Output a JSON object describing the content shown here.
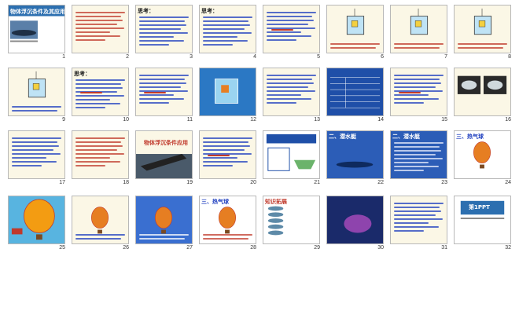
{
  "slides": [
    {
      "n": "1",
      "style": "title",
      "bg": "#ffffff",
      "title": "物体浮沉条件及其应用",
      "title_color": "#c0392b"
    },
    {
      "n": "2",
      "style": "text",
      "bg": "#fbf7e6",
      "line": "#c0392b"
    },
    {
      "n": "3",
      "style": "question",
      "bg": "#fbf7e6",
      "title": "思考：",
      "title_color": "#222222",
      "line": "#1f3fbf"
    },
    {
      "n": "4",
      "style": "text",
      "bg": "#fbf7e6",
      "title": "思考：",
      "title_color": "#222222",
      "line": "#1f3fbf"
    },
    {
      "n": "5",
      "style": "text",
      "bg": "#fbf7e6",
      "line": "#1f3fbf",
      "accent": "#c0392b"
    },
    {
      "n": "6",
      "style": "beaker",
      "bg": "#fbf7e6",
      "line": "#c0392b"
    },
    {
      "n": "7",
      "style": "beaker",
      "bg": "#fbf7e6",
      "line": "#c0392b"
    },
    {
      "n": "8",
      "style": "beaker",
      "bg": "#fbf7e6",
      "line": "#c0392b"
    },
    {
      "n": "9",
      "style": "beaker",
      "bg": "#fbf7e6",
      "line": "#1f3fbf"
    },
    {
      "n": "10",
      "style": "text",
      "bg": "#fbf7e6",
      "title": "思考：",
      "title_color": "#222222",
      "line": "#1f3fbf",
      "accent": "#c0392b"
    },
    {
      "n": "11",
      "style": "text",
      "bg": "#fbf7e6",
      "line": "#1f3fbf",
      "accent": "#c0392b"
    },
    {
      "n": "12",
      "style": "tank",
      "bg": "#2b78c4"
    },
    {
      "n": "13",
      "style": "text",
      "bg": "#fbf7e6",
      "line": "#1f3fbf"
    },
    {
      "n": "14",
      "style": "table",
      "bg": "#1f4fa8"
    },
    {
      "n": "15",
      "style": "question",
      "bg": "#fbf7e6",
      "line": "#1f3fbf",
      "accent": "#c0392b"
    },
    {
      "n": "16",
      "style": "photos",
      "bg": "#fbf7e6"
    },
    {
      "n": "17",
      "style": "text",
      "bg": "#fbf7e6",
      "line": "#1f3fbf"
    },
    {
      "n": "18",
      "style": "text",
      "bg": "#fbf7e6",
      "line": "#c0392b"
    },
    {
      "n": "19",
      "style": "ship",
      "bg": "#fbf7e6",
      "title": "物体浮沉条件应用",
      "title_color": "#c0392b"
    },
    {
      "n": "20",
      "style": "text",
      "bg": "#fbf7e6",
      "line": "#1f3fbf",
      "accent": "#c0392b"
    },
    {
      "n": "21",
      "style": "diagram",
      "bg": "#ffffff"
    },
    {
      "n": "22",
      "style": "sub",
      "bg": "#2c5db7",
      "title": "二、潜水艇",
      "title_color": "#ffffff"
    },
    {
      "n": "23",
      "style": "text",
      "bg": "#2c5db7",
      "title": "二、潜水艇",
      "title_color": "#ffffff",
      "line": "#e8eefc"
    },
    {
      "n": "24",
      "style": "balloon",
      "bg": "#ffffff",
      "title": "三、热气球",
      "title_color": "#1f3fbf"
    },
    {
      "n": "25",
      "style": "bigballoon",
      "bg": "#58b4e0"
    },
    {
      "n": "26",
      "style": "balloon",
      "bg": "#fbf7e6",
      "line": "#1f3fbf"
    },
    {
      "n": "27",
      "style": "balloon",
      "bg": "#3a6fd0",
      "line": "#ffffff"
    },
    {
      "n": "28",
      "style": "balloon",
      "bg": "#ffffff",
      "title": "三、热气球",
      "title_color": "#1f3fbf",
      "line": "#c0392b"
    },
    {
      "n": "29",
      "style": "fish",
      "bg": "#ffffff",
      "title": "知识拓展",
      "title_color": "#c0392b"
    },
    {
      "n": "30",
      "style": "dark",
      "bg": "#1a2a6a"
    },
    {
      "n": "31",
      "style": "text",
      "bg": "#fbf7e6",
      "line": "#1f3fbf"
    },
    {
      "n": "32",
      "style": "logo",
      "bg": "#ffffff",
      "title": "第1PPT",
      "title_color": "#ffffff"
    }
  ]
}
